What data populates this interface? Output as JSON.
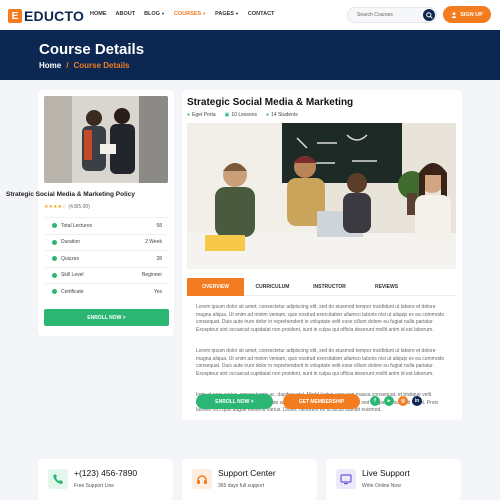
{
  "brand": {
    "name": "EDUCTO",
    "mark": "E"
  },
  "nav": [
    {
      "label": "HOME",
      "active": false,
      "dropdown": false
    },
    {
      "label": "ABOUT",
      "active": false,
      "dropdown": false
    },
    {
      "label": "BLOG",
      "active": false,
      "dropdown": true
    },
    {
      "label": "COURSES",
      "active": true,
      "dropdown": true
    },
    {
      "label": "PAGES",
      "active": false,
      "dropdown": true
    },
    {
      "label": "CONTACT",
      "active": false,
      "dropdown": false
    }
  ],
  "search": {
    "placeholder": "Search Courses"
  },
  "signup_label": "SIGN UP",
  "hero": {
    "title": "Course Details",
    "crumb_home": "Home",
    "crumb_sep": "/",
    "crumb_current": "Course Details"
  },
  "sidebar": {
    "title": "Strategic Social Media & Marketing Policy",
    "stars": "★★★★☆",
    "rating": "(4.8/5.00)",
    "meta": [
      {
        "label": "Total Lectures",
        "value": "58"
      },
      {
        "label": "Duration",
        "value": "2 Week"
      },
      {
        "label": "Quizzes",
        "value": "28"
      },
      {
        "label": "Skill Level",
        "value": "Beginner"
      },
      {
        "label": "Certificate",
        "value": "Yes"
      }
    ],
    "enroll_label": "ENROLL NOW >"
  },
  "course": {
    "title": "Strategic Social Media & Marketing",
    "author": "Eget Porta",
    "lessons": "10 Lessons",
    "students": "14 Students"
  },
  "tabs": [
    "OVERVIEW",
    "CURRICULUM",
    "INSTRUCTOR",
    "REVIEWS"
  ],
  "paragraphs": [
    "Lorem ipsum dolor sit amet, consectetur adipiscing elit, sed do eiusmod tempor incididunt ut labore et dolore magna aliqua. Ut enim ad minim veniam, quis nostrud exercitation ullamco laboris nisi ut aliquip ex ea commodo consequat. Duis aute irure dolor in reprehenderit in voluptate velit esse cillum dolore eu fugiat nulla pariatur. Excepteur sint occaecat cupidatat non proident, sunt in culpa qui officia deserunt mollit anim id est laborum.",
    "Lorem ipsum dolor sit amet, consectetur adipiscing elit, sed do eiusmod tempor incididunt ut labore et dolore magna aliqua. Ut enim ad minim veniam, quis nostrud exercitation ullamco laboris nisi ut aliquip ex ea commodo consequat. Duis aute irure dolor in reprehenderit in voluptate velit esse cillum dolore eu fugiat nulla pariatur. Excepteur sint occaecat cupidatat non proident, sunt in culpa qui officia deserunt mollit anim id est laborum.",
    "Iorin et eros varius, ornare turpis ac, dapibus nisl. Morbi luctus eros non massa consequat, et tristique velit semper. Curabitur interdum vulputate sagittis. Donec erat massa, tincidunt sed feugiat id, suscipit in est. Proin laoreet orci quis augue eleifend varius. Donec hendrerit ex ut lacus blandit euismod."
  ],
  "actions": {
    "enroll_label": "ENROLL NOW >",
    "membership_label": "GET MEMBERSHIP"
  },
  "social": [
    {
      "name": "facebook",
      "glyph": "f",
      "color": "#2bb673"
    },
    {
      "name": "youtube",
      "glyph": "▸",
      "color": "#2bb673"
    },
    {
      "name": "instagram",
      "glyph": "◎",
      "color": "#f47c20"
    },
    {
      "name": "linkedin",
      "glyph": "in",
      "color": "#0c2852"
    }
  ],
  "features": [
    {
      "title": "+(123) 456-7890",
      "sub": "Free Support Line",
      "icon": "phone-icon",
      "bg": "#e4f7ec"
    },
    {
      "title": "Support Center",
      "sub": "365 days full support",
      "icon": "headset-icon",
      "bg": "#fdeee1"
    },
    {
      "title": "Live Support",
      "sub": "Write Online Now",
      "icon": "monitor-icon",
      "bg": "#ece9fb"
    }
  ],
  "colors": {
    "primary": "#f47c20",
    "navy": "#0c2852",
    "green": "#2bb673"
  }
}
